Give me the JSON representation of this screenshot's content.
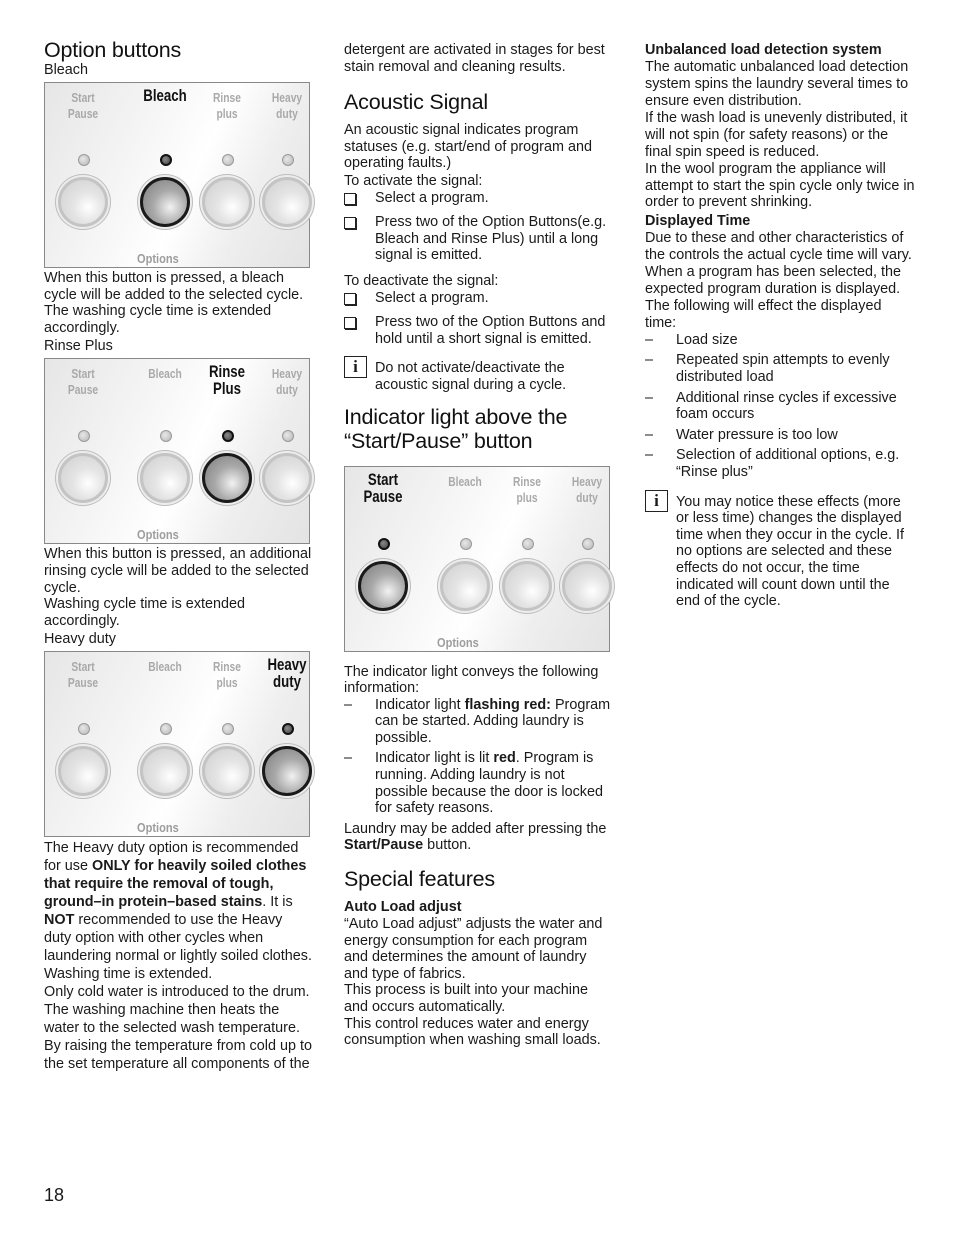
{
  "page_number": "18",
  "column1": {
    "title": "Option buttons",
    "panels": [
      {
        "caption": "Bleach",
        "labels": [
          "Start Pause",
          "Bleach",
          "Rinse plus",
          "Heavy duty"
        ],
        "active_index": 1,
        "footer": "Options",
        "description": [
          "When this button is pressed, a bleach cycle will be added to the selected cycle.",
          "The washing cycle time is extended accordingly."
        ]
      },
      {
        "caption": "Rinse Plus",
        "labels": [
          "Start Pause",
          "Bleach",
          "Rinse Plus",
          "Heavy duty"
        ],
        "active_index": 2,
        "footer": "Options",
        "description": [
          "When this button is pressed, an additional rinsing cycle will be added to the selected cycle.",
          "Washing cycle time is extended accordingly."
        ]
      },
      {
        "caption": "Heavy duty",
        "labels": [
          "Start Pause",
          "Bleach",
          "Rinse plus",
          "Heavy duty"
        ],
        "active_index": 3,
        "footer": "Options"
      }
    ],
    "heavy_duty_text": {
      "p1_a": "The Heavy duty option is recommended for use ",
      "p1_b": "ONLY for heavily soiled clothes that require the removal of tough, ground–in protein–based stains",
      "p1_c": ".  It is ",
      "p1_d": "NOT",
      "p1_e": " recommended to use the Heavy duty option with other cycles when laundering normal or lightly soiled clothes.",
      "p2": "Washing time is extended.",
      "p3": "Only cold water is introduced to the drum. The washing machine then heats the water to the selected wash temperature. By raising the temperature  from cold up to the set temperature all components of the"
    }
  },
  "column2": {
    "continued": "detergent are activated in stages for best stain removal and cleaning results.",
    "acoustic": {
      "title": "Acoustic Signal",
      "intro": "An acoustic signal indicates program statuses (e.g. start/end of program and operating faults.)",
      "activate_label": "To activate the signal:",
      "activate_steps": [
        "Select a program.",
        "Press two of the Option Buttons(e.g. Bleach and Rinse Plus) until a long signal is emitted."
      ],
      "deactivate_label": "To deactivate the signal:",
      "deactivate_steps": [
        "Select a program.",
        "Press two of the Option Buttons and hold until a short signal is emitted."
      ],
      "note_icon": "info-icon",
      "note": "Do not activate/deactivate the acoustic signal during a cycle."
    },
    "indicator": {
      "title_line1": "Indicator light above the",
      "title_line2": "“Start/Pause” button",
      "panel": {
        "labels": [
          "Start Pause",
          "Bleach",
          "Rinse plus",
          "Heavy duty"
        ],
        "active_index": 0,
        "footer": "Options"
      },
      "intro": "The indicator light conveys the following information:",
      "items": [
        {
          "a": "Indicator light ",
          "b": "flashing red:",
          "c": " Program can be started. Adding laundry is possible."
        },
        {
          "a": "Indicator light is lit ",
          "b": "red",
          "c": ". Program is running. Adding laundry is not possible because the door is locked for safety reasons."
        }
      ],
      "outro_a": "Laundry may be added after pressing the ",
      "outro_b": "Start/Pause",
      "outro_c": " button."
    },
    "special": {
      "title": "Special features",
      "subtitle": "Auto Load adjust",
      "paragraphs": [
        "“Auto Load adjust” adjusts the water and energy consumption for each program and determines the amount of laundry and type of fabrics.",
        "This process is built into your machine and occurs automatically.",
        "This control reduces water and energy consumption when washing small loads."
      ]
    }
  },
  "column3": {
    "unbalanced": {
      "title": "Unbalanced load detection system",
      "paragraphs": [
        "The automatic unbalanced load detection system spins the laundry several times to ensure even distribution.",
        "If the wash load is unevenly distributed, it will not spin (for safety reasons) or the final spin speed is reduced.",
        "In the wool program the appliance will attempt to start the spin cycle only twice in order to prevent shrinking."
      ]
    },
    "displayed_time": {
      "title": "Displayed Time",
      "paragraphs": [
        "Due to these and other characteristics of the controls the actual cycle time will vary.",
        "When a program has been selected, the expected program duration is displayed.",
        "The following will effect the displayed time:"
      ],
      "items": [
        "Load size",
        "Repeated spin attempts to evenly distributed load",
        "Additional rinse cycles if excessive foam occurs",
        "Water pressure is too low",
        "Selection of additional options, e.g. “Rinse plus”"
      ],
      "note_icon": "info-icon",
      "note": "You may notice these effects (more or less time) changes the displayed time when they occur in the cycle. If no options are selected and these effects do not occur, the time indicated will count down until the end of the cycle."
    }
  },
  "symbols": {
    "dash": "–",
    "info": "i"
  }
}
